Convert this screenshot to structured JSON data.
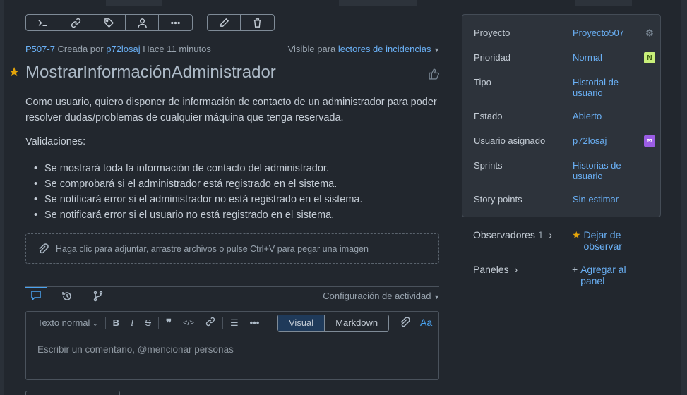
{
  "issue": {
    "key": "P507-7",
    "created_by_prefix": "Creada por",
    "author": "p72losaj",
    "time": "Hace 11 minutos",
    "visibility_prefix": "Visible para",
    "visibility_value": "lectores de incidencias",
    "title": "MostrarInformaciónAdministrador",
    "description": "Como usuario, quiero disponer de información de contacto de un administrador para poder resolver dudas/problemas de cualquier máquina que tenga reservada.",
    "validations_heading": "Validaciones:",
    "validations": [
      "Se mostrará toda la información de contacto del administrador.",
      "Se comprobará si el administrador está registrado en el sistema.",
      "Se notificará error si el administrador no está registrado en el sistema.",
      "Se notificará error si el usuario no está registrado en el sistema."
    ]
  },
  "attach_hint": "Haga clic para adjuntar, arrastre archivos o pulse Ctrl+V para pegar una imagen",
  "activity": {
    "config_label": "Configuración de actividad"
  },
  "editor": {
    "text_style": "Texto normal",
    "mode_visual": "Visual",
    "mode_markdown": "Markdown",
    "aa_label": "Aa",
    "placeholder": "Escribir un comentario, @mencionar personas"
  },
  "sidebar": {
    "fields": [
      {
        "label": "Proyecto",
        "value": "Proyecto507"
      },
      {
        "label": "Prioridad",
        "value": "Normal",
        "badge": "N"
      },
      {
        "label": "Tipo",
        "value": "Historial de usuario"
      },
      {
        "label": "Estado",
        "value": "Abierto"
      },
      {
        "label": "Usuario asignado",
        "value": "p72losaj",
        "badge": "P7"
      },
      {
        "label": "Sprints",
        "value": "Historias de usuario"
      },
      {
        "label": "Story points",
        "value": "Sin estimar"
      }
    ],
    "observers_label": "Observadores",
    "observers_count": "1",
    "observers_action": "Dejar de observar",
    "panels_label": "Paneles",
    "panels_action": "Agregar al panel"
  },
  "colors": {
    "background": "#22272e",
    "link": "#6ab0f5",
    "accent": "#4aa3f0",
    "star": "#e5a50a",
    "priority_badge": "#c9f07a",
    "avatar_badge": "#9b5de5"
  }
}
